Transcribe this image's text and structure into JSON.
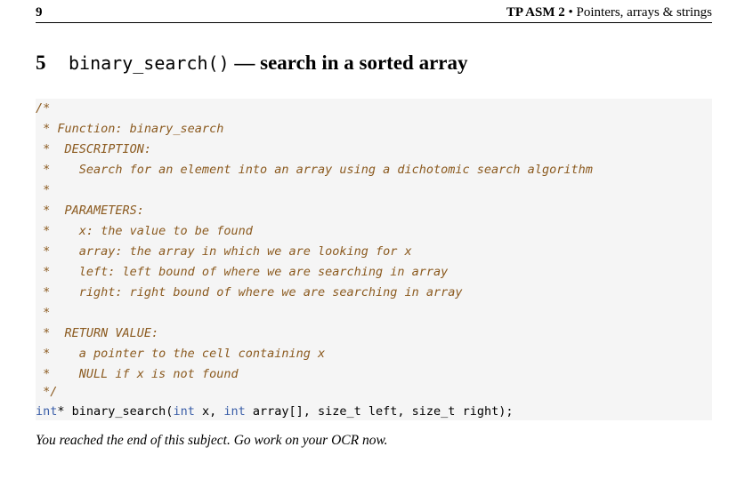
{
  "header": {
    "page_number": "9",
    "doc_title": "TP ASM 2",
    "bullet": "•",
    "doc_subtitle": "Pointers, arrays & strings"
  },
  "section": {
    "number": "5",
    "function_name": "binary_search()",
    "title_rest": " — search in a sorted array"
  },
  "code": {
    "comment_lines": [
      "/*",
      " * Function: binary_search",
      " *  DESCRIPTION:",
      " *    Search for an element into an array using a dichotomic search algorithm",
      " *",
      " *  PARAMETERS:",
      " *    x: the value to be found",
      " *    array: the array in which we are looking for x",
      " *    left: left bound of where we are searching in array",
      " *    right: right bound of where we are searching in array",
      " *",
      " *  RETURN VALUE:",
      " *    a pointer to the cell containing x",
      " *    NULL if x is not found",
      " */"
    ],
    "signature": {
      "t1": "int",
      "p1": "* binary_search(",
      "t2": "int",
      "p2": " x, ",
      "t3": "int",
      "p3": " array[], size_t left, size_t right);"
    }
  },
  "footer_note": "You reached the end of this subject. Go work on your OCR now."
}
